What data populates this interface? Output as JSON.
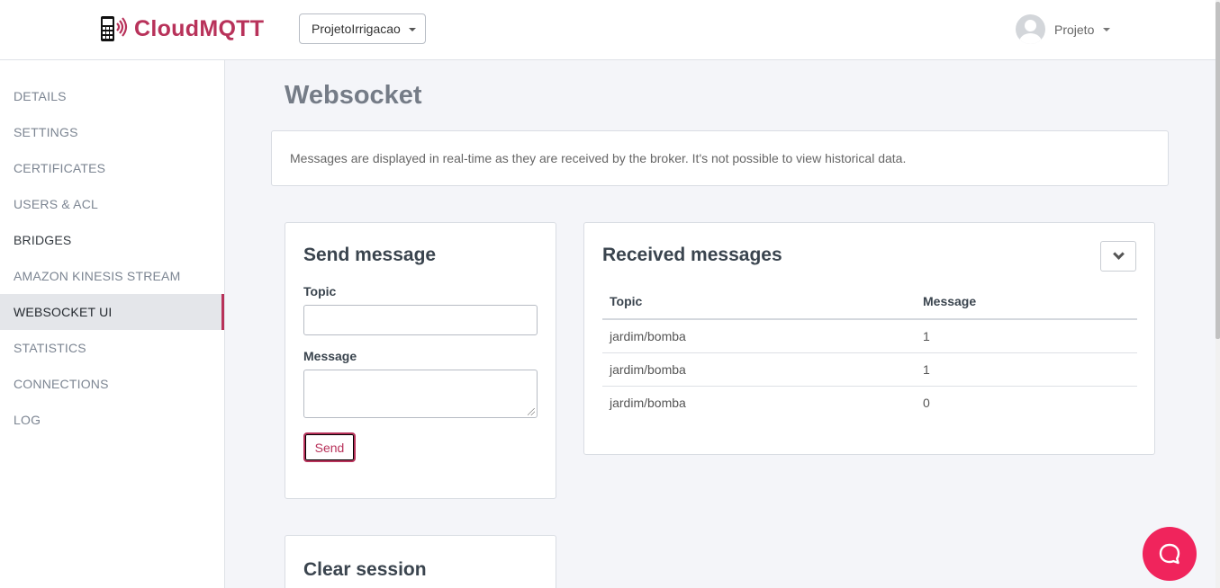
{
  "header": {
    "brand": "CloudMQTT",
    "instance_selector": "ProjetoIrrigacao",
    "user_name": "Projeto"
  },
  "sidebar": {
    "items": [
      {
        "label": "DETAILS"
      },
      {
        "label": "SETTINGS"
      },
      {
        "label": "CERTIFICATES"
      },
      {
        "label": "USERS & ACL"
      },
      {
        "label": "BRIDGES"
      },
      {
        "label": "AMAZON KINESIS STREAM"
      },
      {
        "label": "WEBSOCKET UI"
      },
      {
        "label": "STATISTICS"
      },
      {
        "label": "CONNECTIONS"
      },
      {
        "label": "LOG"
      }
    ],
    "active_item": "WEBSOCKET UI"
  },
  "main": {
    "title": "Websocket",
    "info": "Messages are displayed in real-time as they are received by the broker. It's not possible to view historical data.",
    "send": {
      "title": "Send message",
      "topic_label": "Topic",
      "topic_value": "",
      "message_label": "Message",
      "message_value": "",
      "button_label": "Send"
    },
    "received": {
      "title": "Received messages",
      "columns": [
        "Topic",
        "Message"
      ],
      "rows": [
        {
          "topic": "jardim/bomba",
          "message": "1"
        },
        {
          "topic": "jardim/bomba",
          "message": "1"
        },
        {
          "topic": "jardim/bomba",
          "message": "0"
        }
      ]
    },
    "clear": {
      "title": "Clear session"
    }
  },
  "colors": {
    "brand": "#b8325a",
    "chat_button": "#f0245c",
    "background": "#f4f5f9"
  },
  "icons": [
    "phone-signal-logo-icon",
    "caret-down-icon",
    "avatar-icon",
    "chevron-down-icon",
    "chat-bubble-icon"
  ]
}
